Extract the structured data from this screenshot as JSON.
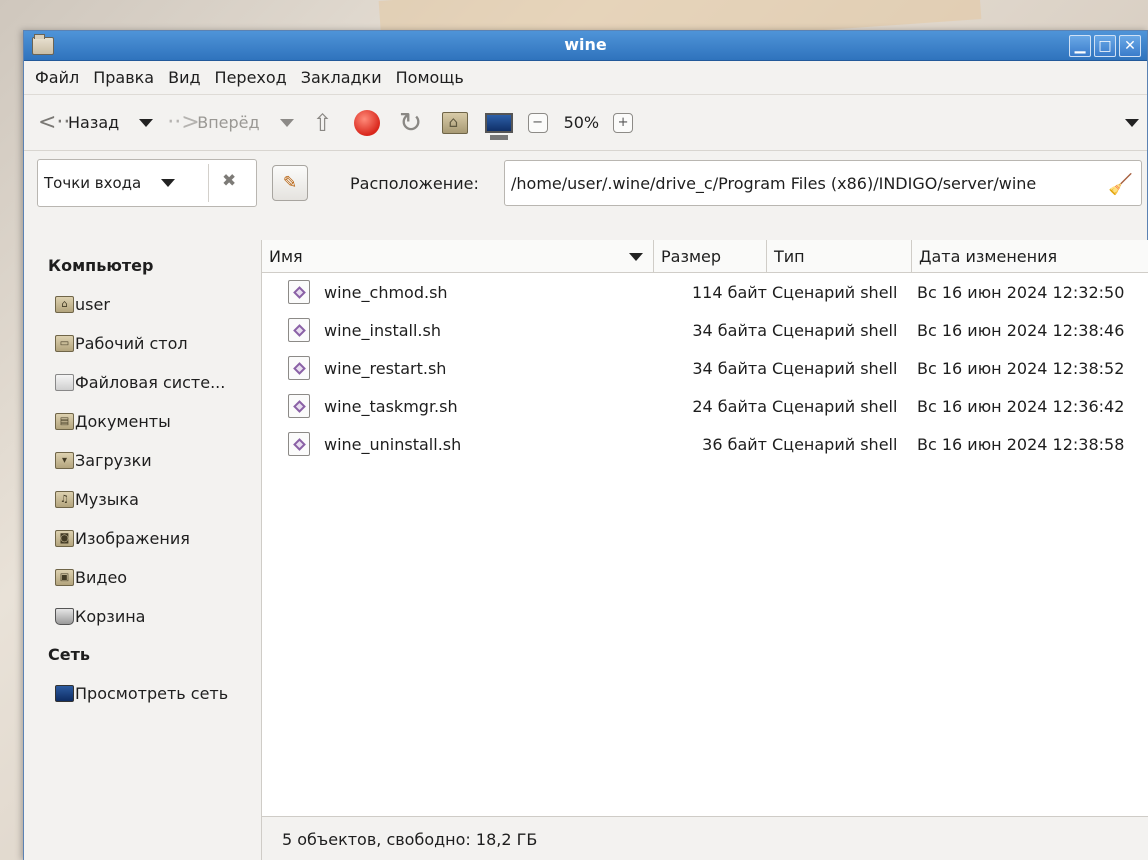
{
  "window": {
    "title": "wine",
    "buttons": [
      "minimize",
      "maximize",
      "close"
    ]
  },
  "menu": [
    "Файл",
    "Правка",
    "Вид",
    "Переход",
    "Закладки",
    "Помощь"
  ],
  "toolbar": {
    "back_label": "Назад",
    "forward_label": "Вперёд",
    "zoom": "50%",
    "icons": [
      "back-arrow-icon",
      "forward-arrow-icon",
      "up-icon",
      "stop-icon",
      "reload-icon",
      "home-icon",
      "computer-icon",
      "zoom-out-icon",
      "zoom-in-icon"
    ]
  },
  "location": {
    "places_combo": "Точки входа",
    "label": "Расположение:",
    "path": "/home/user/.wine/drive_c/Program Files (x86)/INDIGO/server/wine"
  },
  "sidebar": {
    "sections": [
      {
        "title": "Компьютер",
        "items": [
          {
            "label": "user",
            "icon": "home-folder-icon"
          },
          {
            "label": "Рабочий стол",
            "icon": "desktop-folder-icon"
          },
          {
            "label": "Файловая систе...",
            "icon": "filesystem-icon"
          },
          {
            "label": "Документы",
            "icon": "documents-folder-icon"
          },
          {
            "label": "Загрузки",
            "icon": "downloads-folder-icon"
          },
          {
            "label": "Музыка",
            "icon": "music-folder-icon"
          },
          {
            "label": "Изображения",
            "icon": "pictures-folder-icon"
          },
          {
            "label": "Видео",
            "icon": "videos-folder-icon"
          },
          {
            "label": "Корзина",
            "icon": "trash-icon"
          }
        ]
      },
      {
        "title": "Сеть",
        "items": [
          {
            "label": "Просмотреть сеть",
            "icon": "network-icon"
          }
        ]
      }
    ]
  },
  "columns": {
    "name": "Имя",
    "size": "Размер",
    "type": "Тип",
    "date": "Дата изменения"
  },
  "files": [
    {
      "name": "wine_chmod.sh",
      "size": "114 байт",
      "type": "Сценарий shell",
      "date": "Вс 16 июн 2024 12:32:50"
    },
    {
      "name": "wine_install.sh",
      "size": "34 байта",
      "type": "Сценарий shell",
      "date": "Вс 16 июн 2024 12:38:46"
    },
    {
      "name": "wine_restart.sh",
      "size": "34 байта",
      "type": "Сценарий shell",
      "date": "Вс 16 июн 2024 12:38:52"
    },
    {
      "name": "wine_taskmgr.sh",
      "size": "24 байта",
      "type": "Сценарий shell",
      "date": "Вс 16 июн 2024 12:36:42"
    },
    {
      "name": "wine_uninstall.sh",
      "size": "36 байт",
      "type": "Сценарий shell",
      "date": "Вс 16 июн 2024 12:38:58"
    }
  ],
  "status": "5 объектов, свободно: 18,2 ГБ",
  "colors": {
    "titlebar": "#2f73bd",
    "stop": "#d9271c",
    "script_icon": "#8a61a6"
  }
}
